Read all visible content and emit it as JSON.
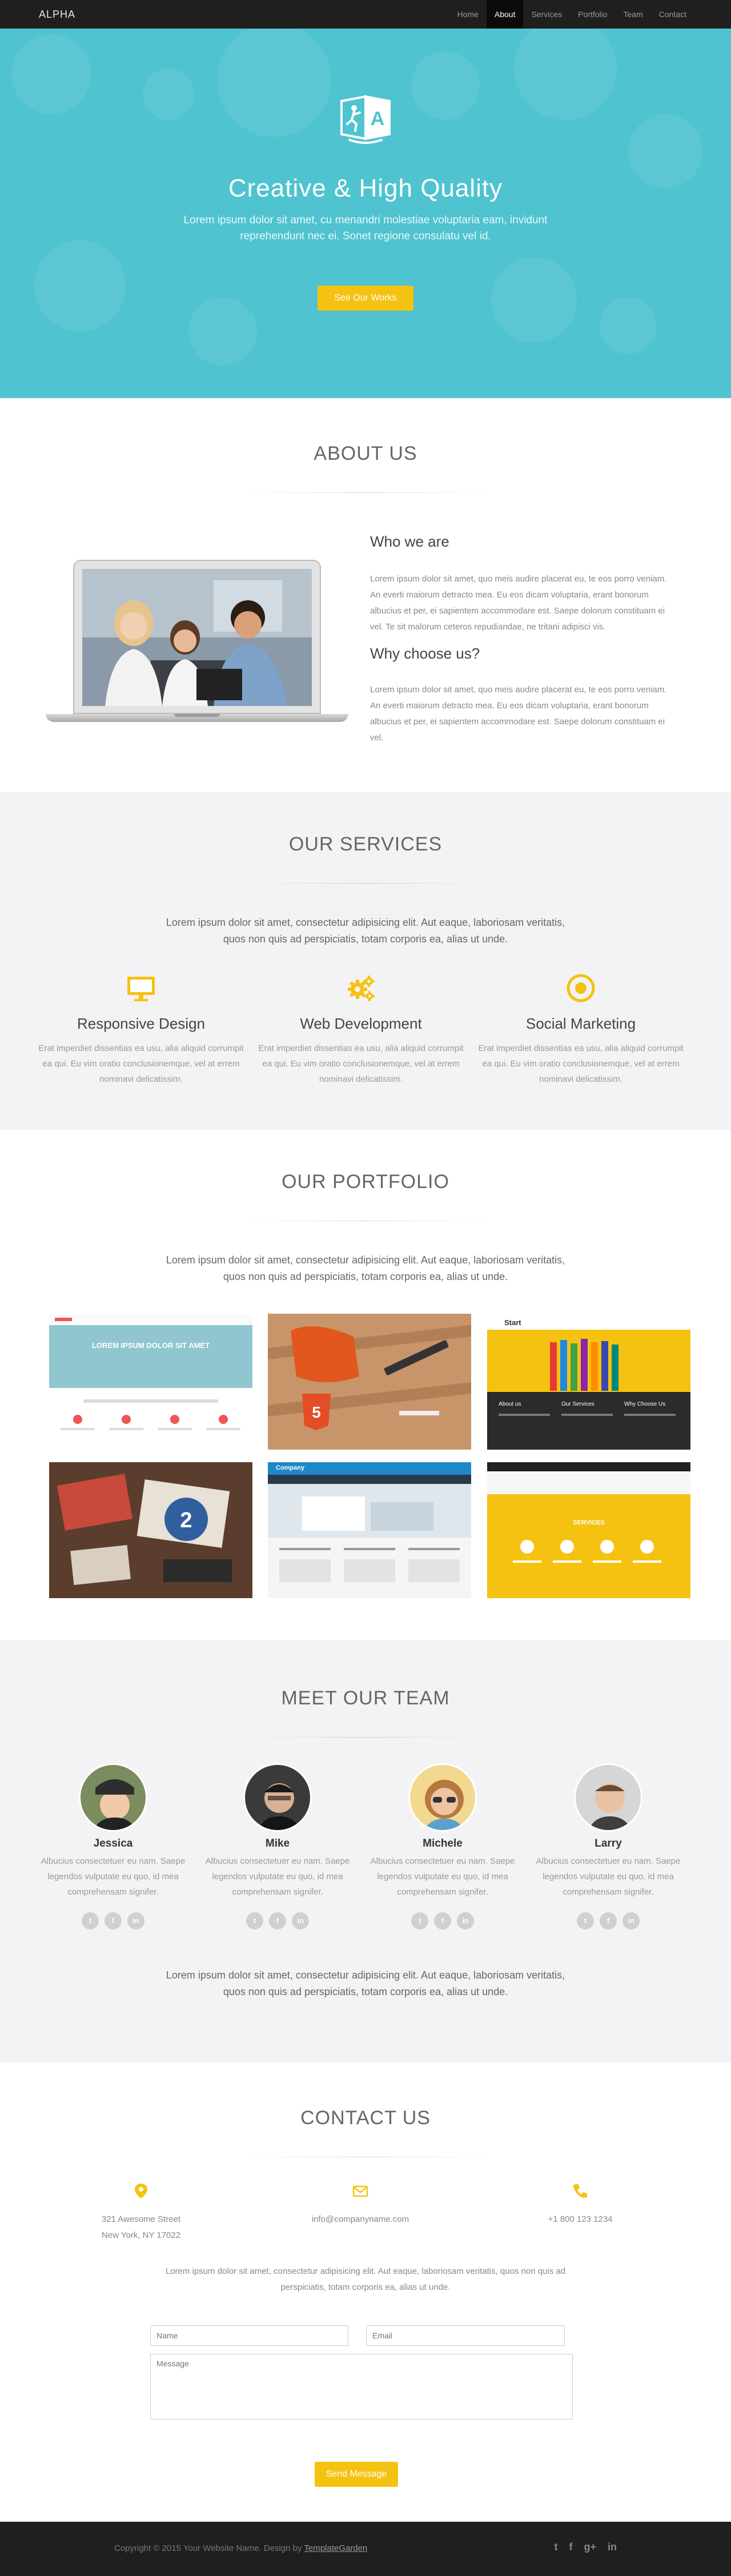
{
  "nav": {
    "brand": "ALPHA",
    "items": [
      {
        "label": "Home"
      },
      {
        "label": "About"
      },
      {
        "label": "Services"
      },
      {
        "label": "Portfolio"
      },
      {
        "label": "Team"
      },
      {
        "label": "Contact"
      }
    ],
    "active": "About"
  },
  "hero": {
    "title": "Creative & High Quality",
    "subtitle": "Lorem ipsum dolor sit amet, cu menandri molestiae voluptaria eam, invidunt reprehendunt nec ei. Sonet regione consulatu vel id.",
    "button": "See Our Works"
  },
  "about": {
    "title": "ABOUT US",
    "who_title": "Who we are",
    "who_text": "Lorem ipsum dolor sit amet, quo meis audire placerat eu, te eos porro veniam. An everti maiorum detracto mea. Eu eos dicam voluptaria, erant bonorum albucius et per, ei sapientem accommodare est. Saepe dolorum constituam ei vel. Te sit malorum ceteros repudiandae, ne tritani adipisci vis.",
    "why_title": "Why choose us?",
    "why_text": "Lorem ipsum dolor sit amet, quo meis audire placerat eu, te eos porro veniam. An everti maiorum detracto mea. Eu eos dicam voluptaria, erant bonorum albucius et per, ei sapientem accommodare est. Saepe dolorum constituam ei vel."
  },
  "services": {
    "title": "OUR SERVICES",
    "intro": "Lorem ipsum dolor sit amet, consectetur adipisicing elit. Aut eaque, laboriosam veritatis, quos non quis ad perspiciatis, totam corporis ea, alias ut unde.",
    "items": [
      {
        "icon": "monitor-icon",
        "title": "Responsive Design",
        "text": "Erat imperdiet dissentias ea usu, alia aliquid corrumpit ea qui. Eu vim oratio conclusionemque, vel at errem nominavi delicatissim."
      },
      {
        "icon": "gears-icon",
        "title": "Web Development",
        "text": "Erat imperdiet dissentias ea usu, alia aliquid corrumpit ea qui. Eu vim oratio conclusionemque, vel at errem nominavi delicatissim."
      },
      {
        "icon": "target-icon",
        "title": "Social Marketing",
        "text": "Erat imperdiet dissentias ea usu, alia aliquid corrumpit ea qui. Eu vim oratio conclusionemque, vel at errem nominavi delicatissim."
      }
    ]
  },
  "portfolio": {
    "title": "OUR PORTFOLIO",
    "intro": "Lorem ipsum dolor sit amet, consectetur adipisicing elit. Aut eaque, laboriosam veritatis, quos non quis ad perspiciatis, totam corporis ea, alias ut unde.",
    "thumb1_headline": "LOREM IPSUM DOLOR SIT AMET",
    "thumb3_brand": "Start",
    "thumb3_cols": [
      "About us",
      "Our Services",
      "Why Choose Us"
    ],
    "thumb5_brand": "Company",
    "thumb6_label": "SERVICES"
  },
  "team": {
    "title": "MEET OUR TEAM",
    "members": [
      {
        "name": "Jessica",
        "bio": "Albucius consectetuer eu nam. Saepe legendos vulputate eu quo, id mea comprehensam signifer."
      },
      {
        "name": "Mike",
        "bio": "Albucius consectetuer eu nam. Saepe legendos vulputate eu quo, id mea comprehensam signifer."
      },
      {
        "name": "Michele",
        "bio": "Albucius consectetuer eu nam. Saepe legendos vulputate eu quo, id mea comprehensam signifer."
      },
      {
        "name": "Larry",
        "bio": "Albucius consectetuer eu nam. Saepe legendos vulputate eu quo, id mea comprehensam signifer."
      }
    ],
    "social_glyphs": {
      "twitter": "t",
      "facebook": "f",
      "linkedin": "in"
    },
    "outro": "Lorem ipsum dolor sit amet, consectetur adipisicing elit. Aut eaque, laboriosam veritatis, quos non quis ad perspiciatis, totam corporis ea, alias ut unde."
  },
  "contact": {
    "title": "CONTACT US",
    "address_line1": "321 Awesome Street",
    "address_line2": "New York, NY 17022",
    "email": "info@companyname.com",
    "phone": "+1 800 123 1234",
    "intro": "Lorem ipsum dolor sit amet, consectetur adipisicing elit. Aut eaque, laboriosam veritatis, quos non quis ad perspiciatis, totam corporis ea, alias ut unde.",
    "name_placeholder": "Name",
    "email_placeholder": "Email",
    "message_placeholder": "Message",
    "send": "Send Message"
  },
  "footer": {
    "copyright": "Copyright © 2015 Your Website Name. Design by ",
    "link": "TemplateGarden",
    "social_glyphs": {
      "twitter": "t",
      "facebook": "f",
      "googleplus": "g+",
      "linkedin": "in"
    }
  },
  "colors": {
    "accent": "#f5c211",
    "hero": "#4fc3cf",
    "nav": "#1f1f1f",
    "alt_bg": "#f3f3f5"
  }
}
